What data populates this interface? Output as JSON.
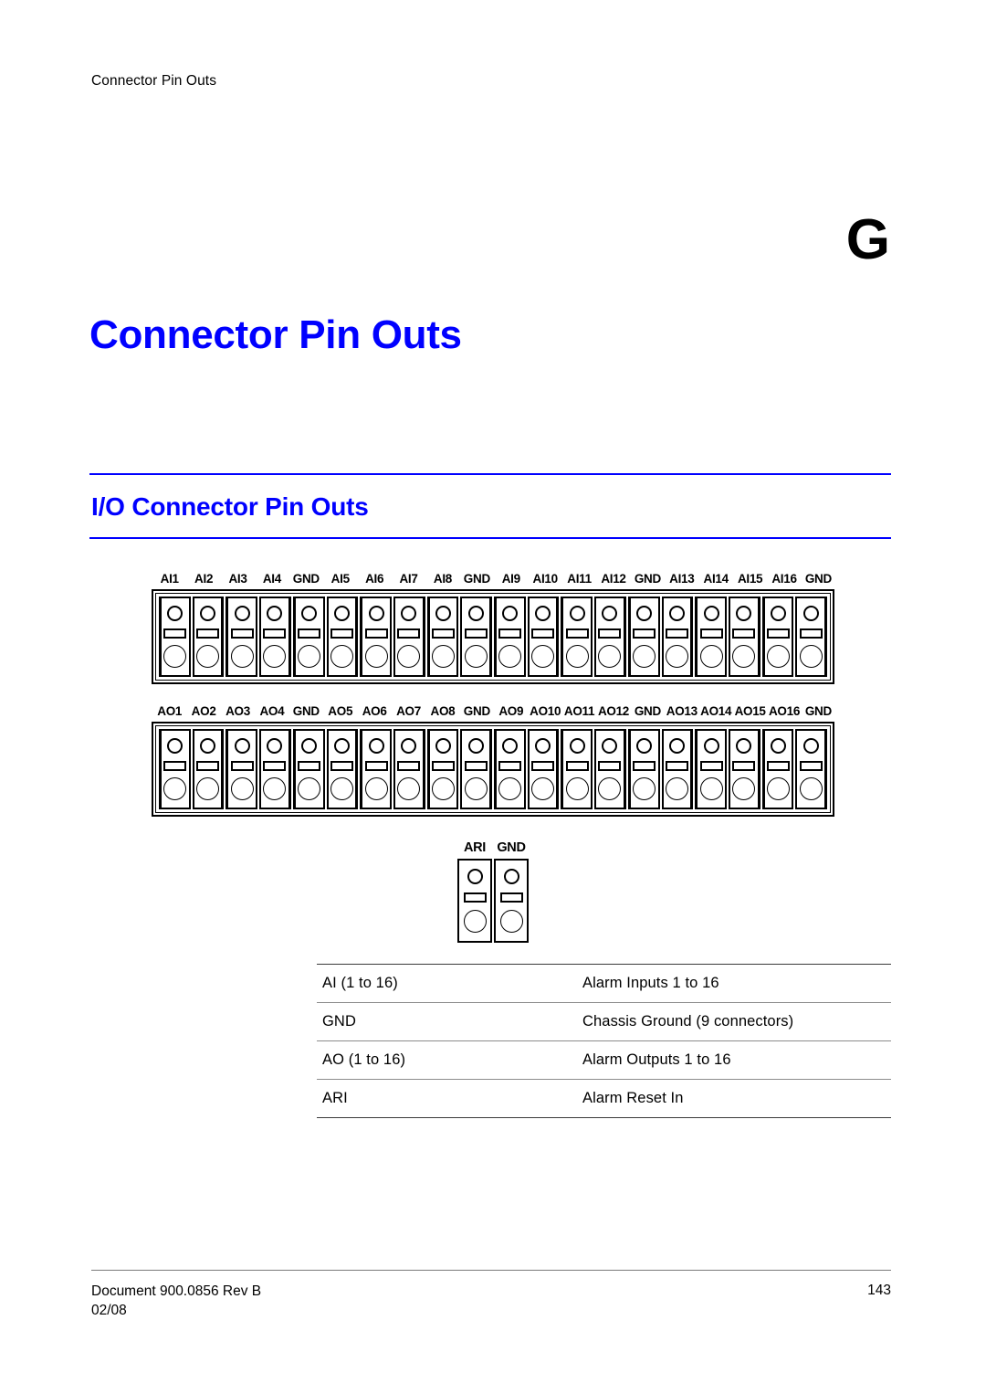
{
  "header": {
    "running_title": "Connector Pin Outs"
  },
  "chapter": {
    "letter": "G",
    "title": "Connector Pin Outs"
  },
  "section": {
    "heading": "I/O Connector Pin Outs"
  },
  "connectors": {
    "alarm_input": {
      "name": "alarm-input-connector",
      "pins": [
        "AI1",
        "AI2",
        "AI3",
        "AI4",
        "GND",
        "AI5",
        "AI6",
        "AI7",
        "AI8",
        "GND",
        "AI9",
        "AI10",
        "AI11",
        "AI12",
        "GND",
        "AI13",
        "AI14",
        "AI15",
        "AI16",
        "GND"
      ]
    },
    "alarm_output": {
      "name": "alarm-output-connector",
      "pins": [
        "AO1",
        "AO2",
        "AO3",
        "AO4",
        "GND",
        "AO5",
        "AO6",
        "AO7",
        "AO8",
        "GND",
        "AO9",
        "AO10",
        "AO11",
        "AO12",
        "GND",
        "AO13",
        "AO14",
        "AO15",
        "AO16",
        "GND"
      ]
    },
    "alarm_reset": {
      "name": "alarm-reset-connector",
      "pins": [
        "ARI",
        "GND"
      ]
    }
  },
  "legend": {
    "rows": [
      {
        "term": "AI (1 to 16)",
        "description": "Alarm Inputs 1 to 16"
      },
      {
        "term": "GND",
        "description": "Chassis Ground (9 connectors)"
      },
      {
        "term": "AO (1 to 16)",
        "description": "Alarm Outputs 1 to 16"
      },
      {
        "term": "ARI",
        "description": "Alarm Reset In"
      }
    ]
  },
  "footer": {
    "document": "Document 900.0856 Rev B",
    "date": "02/08",
    "page_number": "143"
  },
  "colors": {
    "heading_blue": "#0000ff",
    "text_black": "#000000",
    "rule_gray": "#8c8c8c"
  }
}
